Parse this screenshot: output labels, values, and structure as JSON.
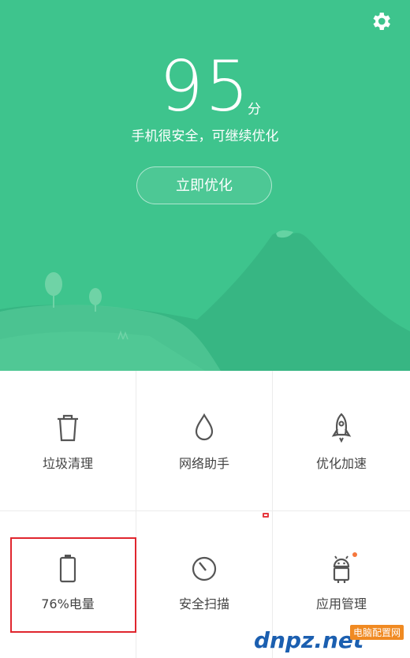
{
  "header": {
    "score": "95",
    "score_unit": "分",
    "status": "手机很安全，可继续优化",
    "optimize_label": "立即优化",
    "settings_icon": "gear-icon"
  },
  "tools": [
    {
      "label": "垃圾清理",
      "icon": "trash-icon"
    },
    {
      "label": "网络助手",
      "icon": "water-drop-icon"
    },
    {
      "label": "优化加速",
      "icon": "rocket-icon"
    },
    {
      "label": "76%电量",
      "icon": "battery-icon"
    },
    {
      "label": "安全扫描",
      "icon": "scan-dial-icon"
    },
    {
      "label": "应用管理",
      "icon": "android-icon"
    }
  ],
  "watermark": {
    "text": "dnpz.net",
    "sub": "电脑配置网"
  },
  "colors": {
    "hero_bg": "#3ec48d",
    "highlight": "#e0262e",
    "badge": "#f5773d"
  }
}
